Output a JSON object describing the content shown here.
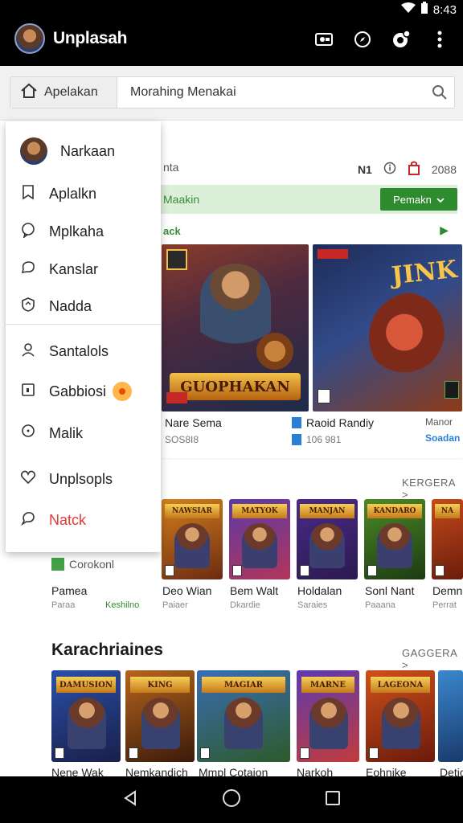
{
  "status_bar": {
    "time": "8:43"
  },
  "app_bar": {
    "title": "Unplasah"
  },
  "search": {
    "scope_label": "Apelakan",
    "query": "Morahing Menakai"
  },
  "drawer": {
    "items": [
      {
        "label": "Narkaan"
      },
      {
        "label": "Aplalkn"
      },
      {
        "label": "Mplkaha"
      },
      {
        "label": "Kanslar"
      },
      {
        "label": "Nadda"
      },
      {
        "label": "Santalols"
      },
      {
        "label": "Gabbiosi"
      },
      {
        "label": "Malik"
      },
      {
        "label": "Unplsopls"
      },
      {
        "label": "Natck",
        "color": "#e53935"
      }
    ]
  },
  "main": {
    "header": {
      "left": "nta",
      "right_code": "N1",
      "right_value": "2088"
    },
    "banner": {
      "text": "Maakin",
      "button": "Pemakn"
    },
    "sub_label": "ack",
    "featured": [
      {
        "logo_text": "GUOPHAKAN",
        "name": "Nare Sema",
        "sub": "SOS8I8"
      },
      {
        "logo_text": "JINK",
        "name": "Raoid Randiy",
        "sub": "106 981",
        "extra_name": "Manor",
        "extra_sub": "Soadan"
      }
    ]
  },
  "section1": {
    "link": "KERGERA >",
    "tag": "Corokonl",
    "games": [
      {
        "title": "Pamea",
        "sub": "Paraa",
        "sub2": "Keshilno"
      },
      {
        "title": "Deo Wian",
        "sub": "Paiaer",
        "card_text": "NAWSIAR"
      },
      {
        "title": "Bem Walt",
        "sub": "Dkardie",
        "card_text": "MATYOK"
      },
      {
        "title": "Holdalan",
        "sub": "Saraies",
        "card_text": "MANJAN"
      },
      {
        "title": "Sonl Nant",
        "sub": "Paaana",
        "card_text": "KANDARO"
      },
      {
        "title": "Demne",
        "sub": "Perrat",
        "card_text": "NA"
      }
    ]
  },
  "section2": {
    "title": "Karachriaines",
    "link": "GAGGERA >",
    "games": [
      {
        "title": "Nene Wak",
        "card_text": "DAMUSION"
      },
      {
        "title": "Nemkandich",
        "card_text": "KING"
      },
      {
        "title": "Mmpl Cotaion",
        "card_text": "MAGIAR"
      },
      {
        "title": "Narkoh",
        "card_text": "MARNE"
      },
      {
        "title": "Eohnike",
        "card_text": "LAGEONA"
      },
      {
        "title": "Detic",
        "card_text": ""
      }
    ]
  },
  "colors": {
    "accent_green": "#2e8b2e",
    "danger": "#e53935",
    "dark_bar": "#000000"
  }
}
